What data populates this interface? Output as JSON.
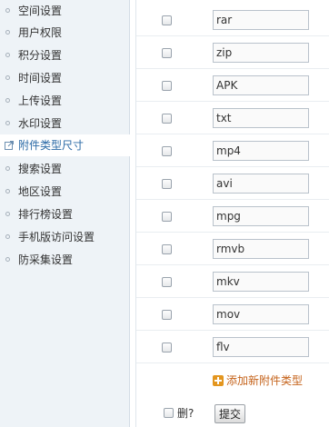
{
  "sidebar": {
    "items": [
      {
        "label": "空间设置",
        "active": false
      },
      {
        "label": "用户权限",
        "active": false
      },
      {
        "label": "积分设置",
        "active": false
      },
      {
        "label": "时间设置",
        "active": false
      },
      {
        "label": "上传设置",
        "active": false
      },
      {
        "label": "水印设置",
        "active": false
      },
      {
        "label": "附件类型尺寸",
        "active": true
      },
      {
        "label": "搜索设置",
        "active": false
      },
      {
        "label": "地区设置",
        "active": false
      },
      {
        "label": "排行榜设置",
        "active": false
      },
      {
        "label": "手机版访问设置",
        "active": false
      },
      {
        "label": "防采集设置",
        "active": false
      }
    ]
  },
  "attachment_types": [
    "rar",
    "zip",
    "APK",
    "txt",
    "mp4",
    "avi",
    "mpg",
    "rmvb",
    "mkv",
    "mov",
    "flv"
  ],
  "add_link_label": "添加新附件类型",
  "delete_label": "删?",
  "submit_label": "提交",
  "colors": {
    "sidebar_bg": "#eef3f7",
    "active_text": "#2b6aa6",
    "add_link": "#c5631b",
    "add_icon": "#e3961f"
  }
}
